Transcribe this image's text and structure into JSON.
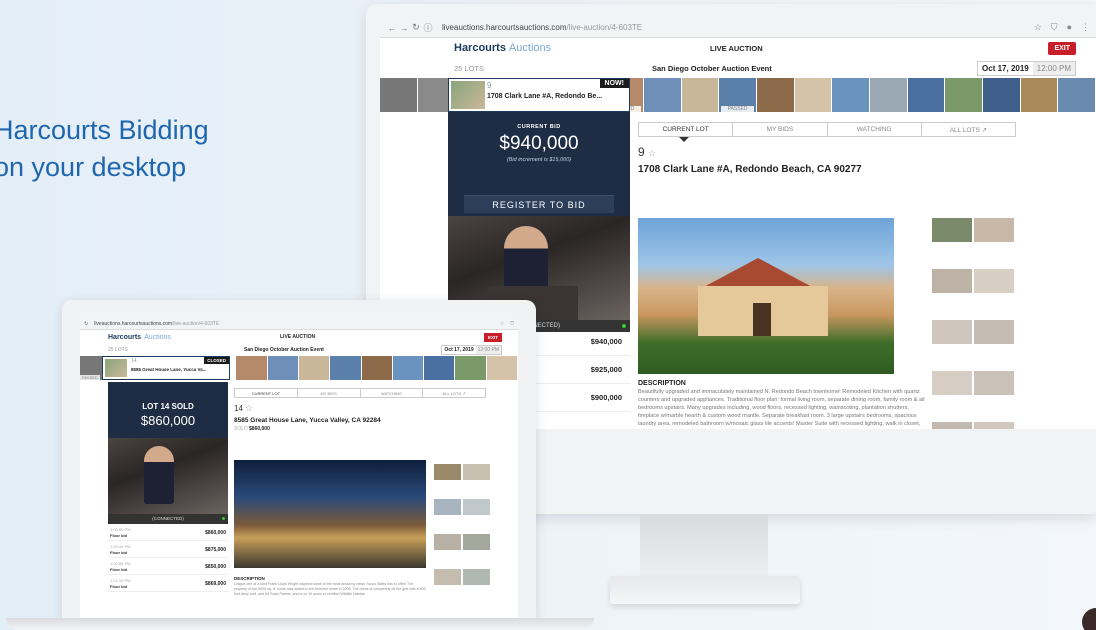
{
  "hero": {
    "line1": "Harcourts Bidding",
    "line2": "on your desktop"
  },
  "colors": {
    "brand_navy": "#1e2d44",
    "accent_blue": "#1e66ad",
    "exit_red": "#c81e2a"
  },
  "desktop": {
    "browser": {
      "url_host": "liveauctions.harcourtsauctions.com",
      "url_path": "/live-auction/4-603TE"
    },
    "header": {
      "logo": "Harcourts",
      "logo_sub": "Auctions",
      "title": "LIVE AUCTION",
      "exit_label": "EXIT"
    },
    "subheader": {
      "lots": "25 LOTS",
      "event": "San Diego October Auction Event",
      "date": "Oct 17, 2019",
      "time": "12:00 PM"
    },
    "current_thumb": {
      "lot": "9",
      "address": "1708 Clark Lane #A, Redondo Be...",
      "badge": "NOW!"
    },
    "thumb_tags": [
      "PASSED",
      "PASSED"
    ],
    "bid": {
      "label": "CURRENT BID",
      "amount": "$940,000",
      "increment": "(Bid increment is $15,000)",
      "register_label": "REGISTER TO BID"
    },
    "video_status": "(CONNECTED)",
    "history": [
      "$940,000",
      "$925,000",
      "$900,000"
    ],
    "tabs": [
      "CURRENT LOT",
      "MY BIDS",
      "WATCHING",
      "ALL LOTS ↗"
    ],
    "lot": {
      "number": "9",
      "address": "1708 Clark Lane #A, Redondo Beach, CA 90277"
    },
    "description_title": "DESCRIPTION",
    "description": "Beautifully upgraded and immaculately maintained N. Redondo Beach townhome! Remodeled Kitchen with quartz counters and upgraded appliances. Traditional floor plan: formal living room, separate dining room, family room & all bedrooms upstairs. Many upgrades including, wood floors, recessed lighting, wainscoting, plantation shutters, fireplace w/marble hearth & custom wood mantle. Separate breakfast room. 3 large upstairs bedrooms, spacious laundry area, remodeled bathroom w/mosaic glass tile accents! Master Suite with recessed lighting, walk in closet, oversized walk-in closet. Huge master bath w/marble counters."
  },
  "laptop": {
    "browser": {
      "url_host": "liveauctions.harcourtsauctions.com",
      "url_path": "/live-auction/4-603TE"
    },
    "header": {
      "logo": "Harcourts",
      "logo_sub": "Auctions",
      "title": "LIVE AUCTION",
      "exit_label": "EXIT"
    },
    "subheader": {
      "lots": "25 LOTS",
      "event": "San Diego October Auction Event",
      "date": "Oct 17, 2019",
      "time": "12:00 PM"
    },
    "current_thumb": {
      "lot": "14",
      "address": "8585 Great House Lane, Yucca Va...",
      "badge": "CLOSED"
    },
    "passed_tag": "PASSED",
    "sold": {
      "title": "LOT 14 SOLD",
      "amount": "$860,000"
    },
    "video_status": "(CONNECTED)",
    "history": [
      {
        "time": "1:00:59 PM",
        "label": "Floor bid",
        "amount": "$860,000"
      },
      {
        "time": "1:00:49 PM",
        "label": "Floor bid",
        "amount": "$875,000"
      },
      {
        "time": "1:00:58 PM",
        "label": "Floor bid",
        "amount": "$850,000"
      },
      {
        "time": "1:01:18 PM",
        "label": "Floor bid",
        "amount": "$869,000"
      }
    ],
    "tabs": [
      "CURRENT LOT",
      "MY BIDS",
      "WATCHING",
      "ALL LOTS ↗"
    ],
    "lot": {
      "number": "14",
      "address": "8585 Great House Lane, Yucca Valley, CA 92284",
      "sold_prefix": "SOLD",
      "sold_amount": "$860,000"
    },
    "description_title": "DESCRIPTION",
    "description": "Unique one of a kind Frank Lloyd Wright inspired home of the most amazing views Yucca Valley has to offer! The property of the 5000 sq. ft. home was added to the finished home in 2008. The home is completely off the grid with a 400 foot deep well, and 60 Solar Panels, and is on 10 acres of certified Wildlife Habitat."
  }
}
